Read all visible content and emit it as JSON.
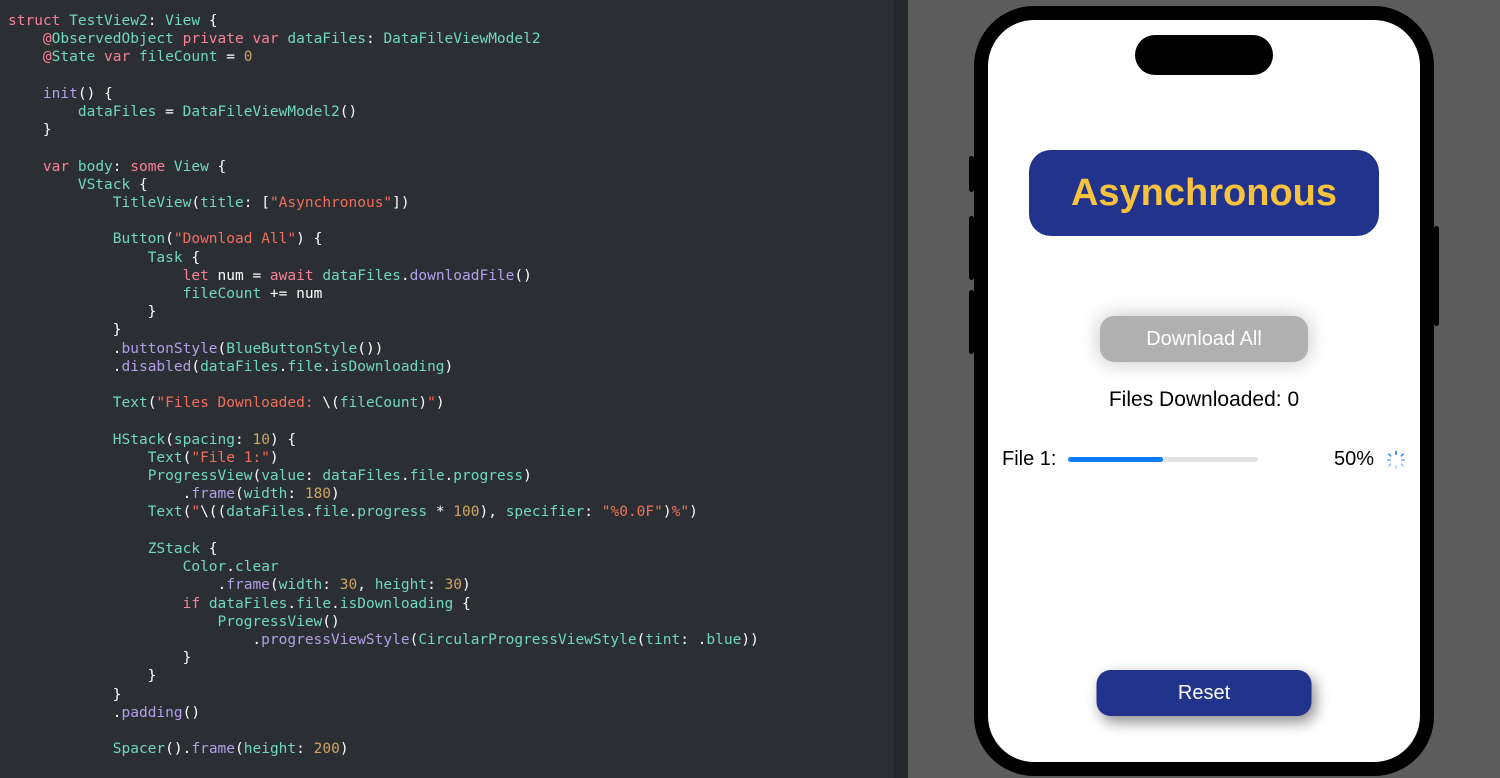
{
  "code": {
    "tokens": [
      [
        [
          "kw",
          "struct"
        ],
        [
          "plain",
          " "
        ],
        [
          "type",
          "TestView2"
        ],
        [
          "plain",
          ": "
        ],
        [
          "type",
          "View"
        ],
        [
          "plain",
          " {"
        ]
      ],
      [
        [
          "plain",
          "    "
        ],
        [
          "at",
          "@"
        ],
        [
          "attr",
          "ObservedObject"
        ],
        [
          "plain",
          " "
        ],
        [
          "kw",
          "private"
        ],
        [
          "plain",
          " "
        ],
        [
          "kw",
          "var"
        ],
        [
          "plain",
          " "
        ],
        [
          "prop",
          "dataFiles"
        ],
        [
          "plain",
          ": "
        ],
        [
          "type",
          "DataFileViewModel2"
        ]
      ],
      [
        [
          "plain",
          "    "
        ],
        [
          "at",
          "@"
        ],
        [
          "attr",
          "State"
        ],
        [
          "plain",
          " "
        ],
        [
          "kw",
          "var"
        ],
        [
          "plain",
          " "
        ],
        [
          "prop",
          "fileCount"
        ],
        [
          "plain",
          " = "
        ],
        [
          "num",
          "0"
        ]
      ],
      [],
      [
        [
          "plain",
          "    "
        ],
        [
          "call",
          "init"
        ],
        [
          "plain",
          "() {"
        ]
      ],
      [
        [
          "plain",
          "        "
        ],
        [
          "prop",
          "dataFiles"
        ],
        [
          "plain",
          " = "
        ],
        [
          "type",
          "DataFileViewModel2"
        ],
        [
          "plain",
          "()"
        ]
      ],
      [
        [
          "plain",
          "    }"
        ]
      ],
      [],
      [
        [
          "plain",
          "    "
        ],
        [
          "kw",
          "var"
        ],
        [
          "plain",
          " "
        ],
        [
          "prop",
          "body"
        ],
        [
          "plain",
          ": "
        ],
        [
          "kw",
          "some"
        ],
        [
          "plain",
          " "
        ],
        [
          "type",
          "View"
        ],
        [
          "plain",
          " {"
        ]
      ],
      [
        [
          "plain",
          "        "
        ],
        [
          "type",
          "VStack"
        ],
        [
          "plain",
          " {"
        ]
      ],
      [
        [
          "plain",
          "            "
        ],
        [
          "type",
          "TitleView"
        ],
        [
          "plain",
          "("
        ],
        [
          "prop",
          "title"
        ],
        [
          "plain",
          ": ["
        ],
        [
          "str",
          "\"Asynchronous\""
        ],
        [
          "plain",
          "])"
        ]
      ],
      [],
      [
        [
          "plain",
          "            "
        ],
        [
          "type",
          "Button"
        ],
        [
          "plain",
          "("
        ],
        [
          "str",
          "\"Download All\""
        ],
        [
          "plain",
          ") {"
        ]
      ],
      [
        [
          "plain",
          "                "
        ],
        [
          "type",
          "Task"
        ],
        [
          "plain",
          " {"
        ]
      ],
      [
        [
          "plain",
          "                    "
        ],
        [
          "kw",
          "let"
        ],
        [
          "plain",
          " num = "
        ],
        [
          "kw",
          "await"
        ],
        [
          "plain",
          " "
        ],
        [
          "prop",
          "dataFiles"
        ],
        [
          "plain",
          "."
        ],
        [
          "call",
          "downloadFile"
        ],
        [
          "plain",
          "()"
        ]
      ],
      [
        [
          "plain",
          "                    "
        ],
        [
          "prop",
          "fileCount"
        ],
        [
          "plain",
          " += num"
        ]
      ],
      [
        [
          "plain",
          "                }"
        ]
      ],
      [
        [
          "plain",
          "            }"
        ]
      ],
      [
        [
          "plain",
          "            ."
        ],
        [
          "call",
          "buttonStyle"
        ],
        [
          "plain",
          "("
        ],
        [
          "type",
          "BlueButtonStyle"
        ],
        [
          "plain",
          "())"
        ]
      ],
      [
        [
          "plain",
          "            ."
        ],
        [
          "call",
          "disabled"
        ],
        [
          "plain",
          "("
        ],
        [
          "prop",
          "dataFiles"
        ],
        [
          "plain",
          "."
        ],
        [
          "prop",
          "file"
        ],
        [
          "plain",
          "."
        ],
        [
          "prop",
          "isDownloading"
        ],
        [
          "plain",
          ")"
        ]
      ],
      [],
      [
        [
          "plain",
          "            "
        ],
        [
          "type",
          "Text"
        ],
        [
          "plain",
          "("
        ],
        [
          "str",
          "\"Files Downloaded: "
        ],
        [
          "plain",
          "\\("
        ],
        [
          "prop",
          "fileCount"
        ],
        [
          "plain",
          ")"
        ],
        [
          "str",
          "\""
        ],
        [
          "plain",
          ")"
        ]
      ],
      [],
      [
        [
          "plain",
          "            "
        ],
        [
          "type",
          "HStack"
        ],
        [
          "plain",
          "("
        ],
        [
          "prop",
          "spacing"
        ],
        [
          "plain",
          ": "
        ],
        [
          "num",
          "10"
        ],
        [
          "plain",
          ") {"
        ]
      ],
      [
        [
          "plain",
          "                "
        ],
        [
          "type",
          "Text"
        ],
        [
          "plain",
          "("
        ],
        [
          "str",
          "\"File 1:\""
        ],
        [
          "plain",
          ")"
        ]
      ],
      [
        [
          "plain",
          "                "
        ],
        [
          "type",
          "ProgressView"
        ],
        [
          "plain",
          "("
        ],
        [
          "prop",
          "value"
        ],
        [
          "plain",
          ": "
        ],
        [
          "prop",
          "dataFiles"
        ],
        [
          "plain",
          "."
        ],
        [
          "prop",
          "file"
        ],
        [
          "plain",
          "."
        ],
        [
          "prop",
          "progress"
        ],
        [
          "plain",
          ")"
        ]
      ],
      [
        [
          "plain",
          "                    ."
        ],
        [
          "call",
          "frame"
        ],
        [
          "plain",
          "("
        ],
        [
          "prop",
          "width"
        ],
        [
          "plain",
          ": "
        ],
        [
          "num",
          "180"
        ],
        [
          "plain",
          ")"
        ]
      ],
      [
        [
          "plain",
          "                "
        ],
        [
          "type",
          "Text"
        ],
        [
          "plain",
          "("
        ],
        [
          "str",
          "\""
        ],
        [
          "plain",
          "\\(("
        ],
        [
          "prop",
          "dataFiles"
        ],
        [
          "plain",
          "."
        ],
        [
          "prop",
          "file"
        ],
        [
          "plain",
          "."
        ],
        [
          "prop",
          "progress"
        ],
        [
          "plain",
          " * "
        ],
        [
          "num",
          "100"
        ],
        [
          "plain",
          "), "
        ],
        [
          "prop",
          "specifier"
        ],
        [
          "plain",
          ": "
        ],
        [
          "str",
          "\"%0.0F\""
        ],
        [
          "plain",
          ")"
        ],
        [
          "str",
          "%\""
        ],
        [
          "plain",
          ")"
        ]
      ],
      [],
      [
        [
          "plain",
          "                "
        ],
        [
          "type",
          "ZStack"
        ],
        [
          "plain",
          " {"
        ]
      ],
      [
        [
          "plain",
          "                    "
        ],
        [
          "type",
          "Color"
        ],
        [
          "plain",
          "."
        ],
        [
          "prop",
          "clear"
        ]
      ],
      [
        [
          "plain",
          "                        ."
        ],
        [
          "call",
          "frame"
        ],
        [
          "plain",
          "("
        ],
        [
          "prop",
          "width"
        ],
        [
          "plain",
          ": "
        ],
        [
          "num",
          "30"
        ],
        [
          "plain",
          ", "
        ],
        [
          "prop",
          "height"
        ],
        [
          "plain",
          ": "
        ],
        [
          "num",
          "30"
        ],
        [
          "plain",
          ")"
        ]
      ],
      [
        [
          "plain",
          "                    "
        ],
        [
          "kw",
          "if"
        ],
        [
          "plain",
          " "
        ],
        [
          "prop",
          "dataFiles"
        ],
        [
          "plain",
          "."
        ],
        [
          "prop",
          "file"
        ],
        [
          "plain",
          "."
        ],
        [
          "prop",
          "isDownloading"
        ],
        [
          "plain",
          " {"
        ]
      ],
      [
        [
          "plain",
          "                        "
        ],
        [
          "type",
          "ProgressView"
        ],
        [
          "plain",
          "()"
        ]
      ],
      [
        [
          "plain",
          "                            ."
        ],
        [
          "call",
          "progressViewStyle"
        ],
        [
          "plain",
          "("
        ],
        [
          "type",
          "CircularProgressViewStyle"
        ],
        [
          "plain",
          "("
        ],
        [
          "prop",
          "tint"
        ],
        [
          "plain",
          ": ."
        ],
        [
          "prop",
          "blue"
        ],
        [
          "plain",
          "))"
        ]
      ],
      [
        [
          "plain",
          "                    }"
        ]
      ],
      [
        [
          "plain",
          "                }"
        ]
      ],
      [
        [
          "plain",
          "            }"
        ]
      ],
      [
        [
          "plain",
          "            ."
        ],
        [
          "call",
          "padding"
        ],
        [
          "plain",
          "()"
        ]
      ],
      [],
      [
        [
          "plain",
          "            "
        ],
        [
          "type",
          "Spacer"
        ],
        [
          "plain",
          "()."
        ],
        [
          "call",
          "frame"
        ],
        [
          "plain",
          "("
        ],
        [
          "prop",
          "height"
        ],
        [
          "plain",
          ": "
        ],
        [
          "num",
          "200"
        ],
        [
          "plain",
          ")"
        ]
      ]
    ]
  },
  "app": {
    "title": "Asynchronous",
    "download_label": "Download All",
    "files_text_prefix": "Files Downloaded: ",
    "files_count": "0",
    "file_label": "File 1:",
    "progress_value": 50,
    "percent_text": "50%",
    "reset_label": "Reset"
  },
  "colors": {
    "banner_bg": "#22338d",
    "banner_fg": "#f7c23c",
    "progress_blue": "#0a7aff"
  }
}
